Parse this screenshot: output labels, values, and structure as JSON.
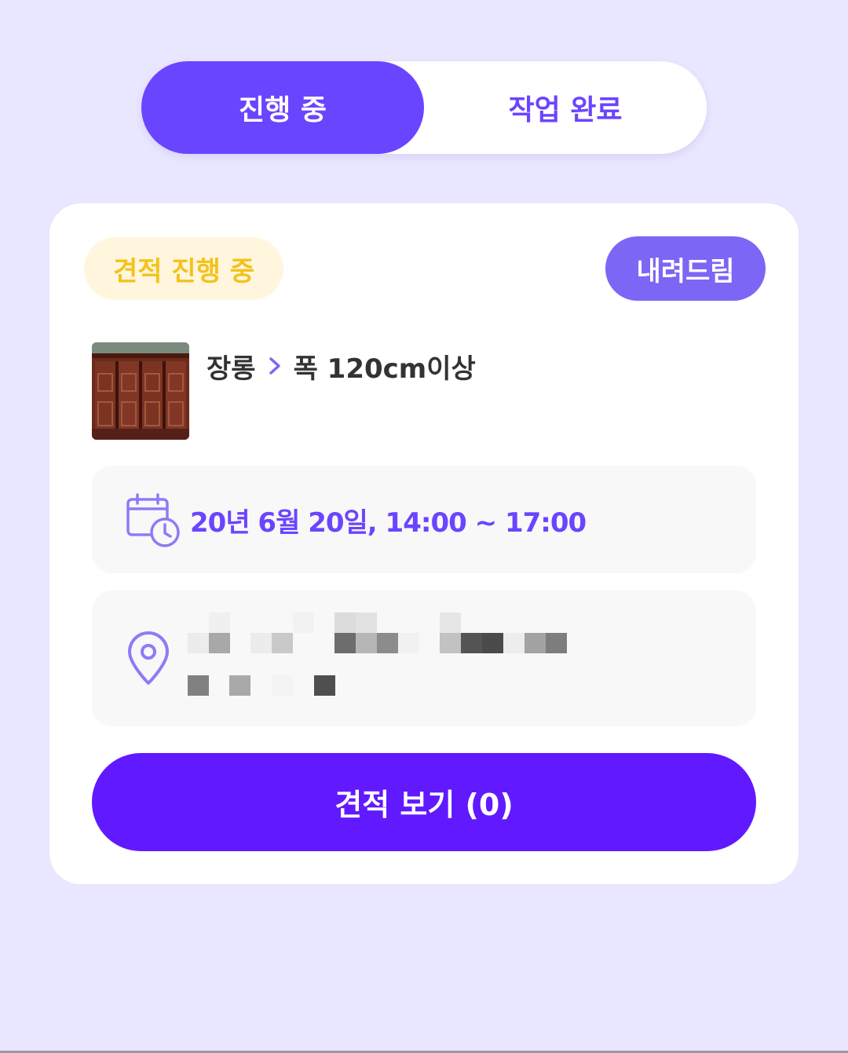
{
  "tabs": {
    "in_progress": "진행 중",
    "completed": "작업 완료"
  },
  "card": {
    "status_badge": "견적 진행 중",
    "delivery_badge": "내려드림",
    "category": {
      "main": "장롱",
      "sub": "폭 120cm이상"
    },
    "schedule": "20년 6월 20일, 14:00 ~ 17:00",
    "address": "",
    "quote_button": "견적 보기 (0)"
  },
  "icons": {
    "calendar": "calendar-clock-icon",
    "location": "location-pin-icon",
    "breadcrumb": "chevron-right-icon"
  },
  "colors": {
    "background": "#e9e6ff",
    "primary": "#6a45ff",
    "button": "#6119ff",
    "status_yellow": "#f4c21c",
    "delivery_badge": "#7c66f5"
  }
}
